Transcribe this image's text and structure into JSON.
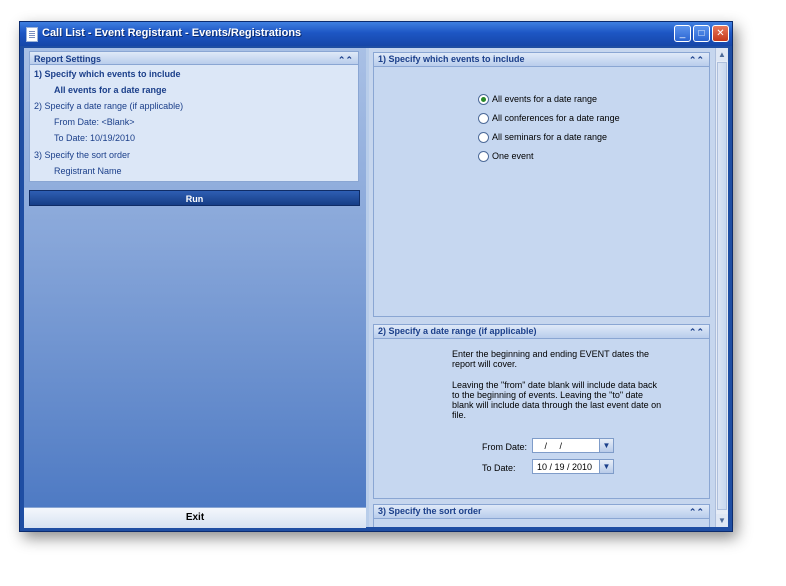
{
  "window": {
    "title": "Call List - Event Registrant - Events/Registrations",
    "controls": {
      "minimize": "minimize-icon",
      "maximize": "maximize-icon",
      "close": "close-icon"
    }
  },
  "left": {
    "report_settings": {
      "header": "Report Settings",
      "items": [
        {
          "text": "1)  Specify which events to include"
        },
        {
          "text": "All events for a date range"
        },
        {
          "text": "2)  Specify a date range (if applicable)"
        },
        {
          "text": "From Date:  <Blank>"
        },
        {
          "text": "To Date:  10/19/2010"
        },
        {
          "text": "3)  Specify the sort order"
        },
        {
          "text": "Registrant Name"
        }
      ]
    },
    "run_label": "Run",
    "exit_label": "Exit"
  },
  "right": {
    "section1": {
      "header": "1)  Specify which events to include",
      "options": [
        {
          "label": "All events for a date range",
          "checked": true
        },
        {
          "label": "All conferences for a date range",
          "checked": false
        },
        {
          "label": "All seminars for a date range",
          "checked": false
        },
        {
          "label": "One event",
          "checked": false
        }
      ]
    },
    "section2": {
      "header": "2)  Specify a date range (if applicable)",
      "info1": "Enter the beginning and ending EVENT dates the report will cover.",
      "info2": "Leaving the \"from\" date blank will include data back to the beginning of events. Leaving the \"to\" date blank will include data through the last event date on file.",
      "from_label": "From Date:",
      "from_value": "   /     /",
      "to_label": "To Date:",
      "to_value": "10 / 19 / 2010"
    },
    "section3": {
      "header": "3)  Specify the sort order"
    }
  },
  "colors": {
    "title_bar": "#1d56c4",
    "run_button": "#1f4a9e",
    "accent_text": "#1b3f8a"
  }
}
